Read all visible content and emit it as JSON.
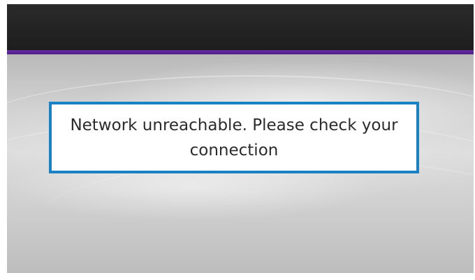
{
  "dialog": {
    "message": "Network unreachable. Please check your connection"
  },
  "colors": {
    "top_bar": "#222222",
    "accent_line": "#5a2396",
    "dialog_border": "#1a82c4",
    "dialog_background": "#ffffff",
    "text": "#2b2b2b"
  }
}
